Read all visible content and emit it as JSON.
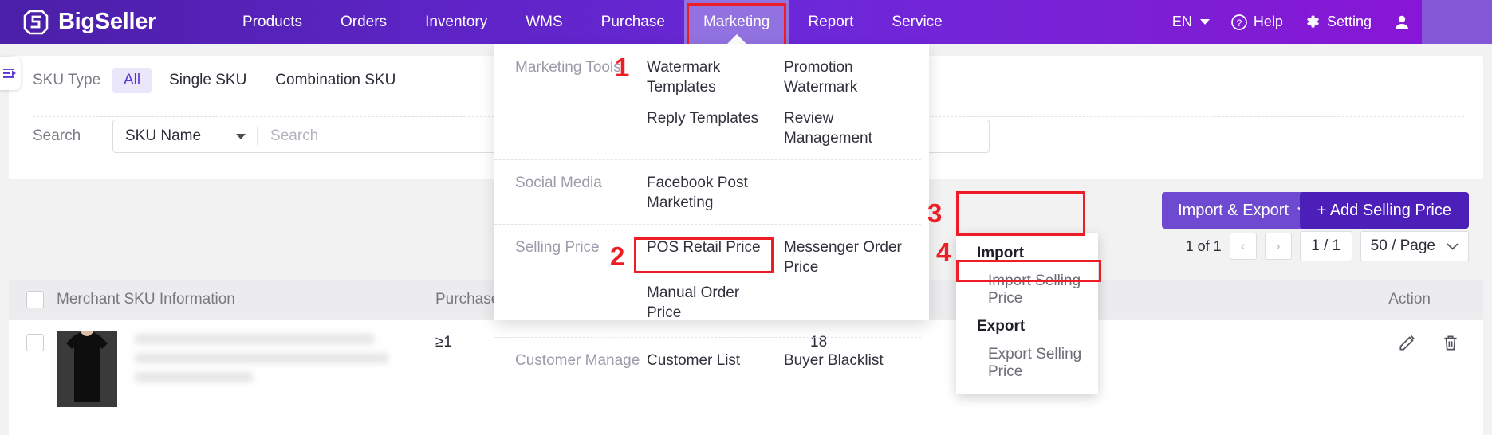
{
  "header": {
    "brand": "BigSeller",
    "nav_items": [
      {
        "label": "Products",
        "active": false
      },
      {
        "label": "Orders",
        "active": false
      },
      {
        "label": "Inventory",
        "active": false
      },
      {
        "label": "WMS",
        "active": false
      },
      {
        "label": "Purchase",
        "active": false
      },
      {
        "label": "Marketing",
        "active": true
      },
      {
        "label": "Report",
        "active": false
      },
      {
        "label": "Service",
        "active": false
      }
    ],
    "language": "EN",
    "help": "Help",
    "setting": "Setting"
  },
  "filters": {
    "sku_type_label": "SKU Type",
    "sku_type_options": [
      "All",
      "Single SKU",
      "Combination SKU"
    ],
    "sku_type_selected": "All",
    "search_label": "Search",
    "search_field_selected": "SKU Name",
    "search_placeholder": "Search"
  },
  "toolbar": {
    "import_export_label": "Import & Export",
    "add_selling_price_label": "+ Add Selling Price",
    "pager_text": "1 of 1",
    "page_indicator": "1 / 1",
    "page_size": "50 / Page"
  },
  "mega_menu": {
    "sections": [
      {
        "category": "Marketing Tools",
        "col1": [
          "Watermark Templates",
          "Reply Templates"
        ],
        "col2": [
          "Promotion Watermark",
          "Review Management"
        ]
      },
      {
        "category": "Social Media",
        "col1": [
          "Facebook Post Marketing"
        ],
        "col2": []
      },
      {
        "category": "Selling Price",
        "col1": [
          "POS Retail Price",
          "Manual Order Price"
        ],
        "col2": [
          "Messenger Order Price"
        ]
      },
      {
        "category": "Customer Manage",
        "col1": [
          "Customer List"
        ],
        "col2": [
          "Buyer Blacklist"
        ]
      }
    ]
  },
  "import_export_menu": {
    "import_head": "Import",
    "import_option": "Import Selling Price",
    "export_head": "Export",
    "export_option": "Export Selling Price"
  },
  "table": {
    "columns": [
      "Merchant SKU Information",
      "Purchase Q",
      "Action"
    ],
    "rows": [
      {
        "purchase_q": "≥1",
        "qty": "18"
      }
    ]
  },
  "annotations": [
    {
      "number": "1"
    },
    {
      "number": "2"
    },
    {
      "number": "3"
    },
    {
      "number": "4"
    }
  ],
  "colors": {
    "brand_purple": "#4c1fb8",
    "accent_purple": "#6d4ad0",
    "annotation_red": "#ee1c25",
    "active_nav": "#9172e0"
  }
}
